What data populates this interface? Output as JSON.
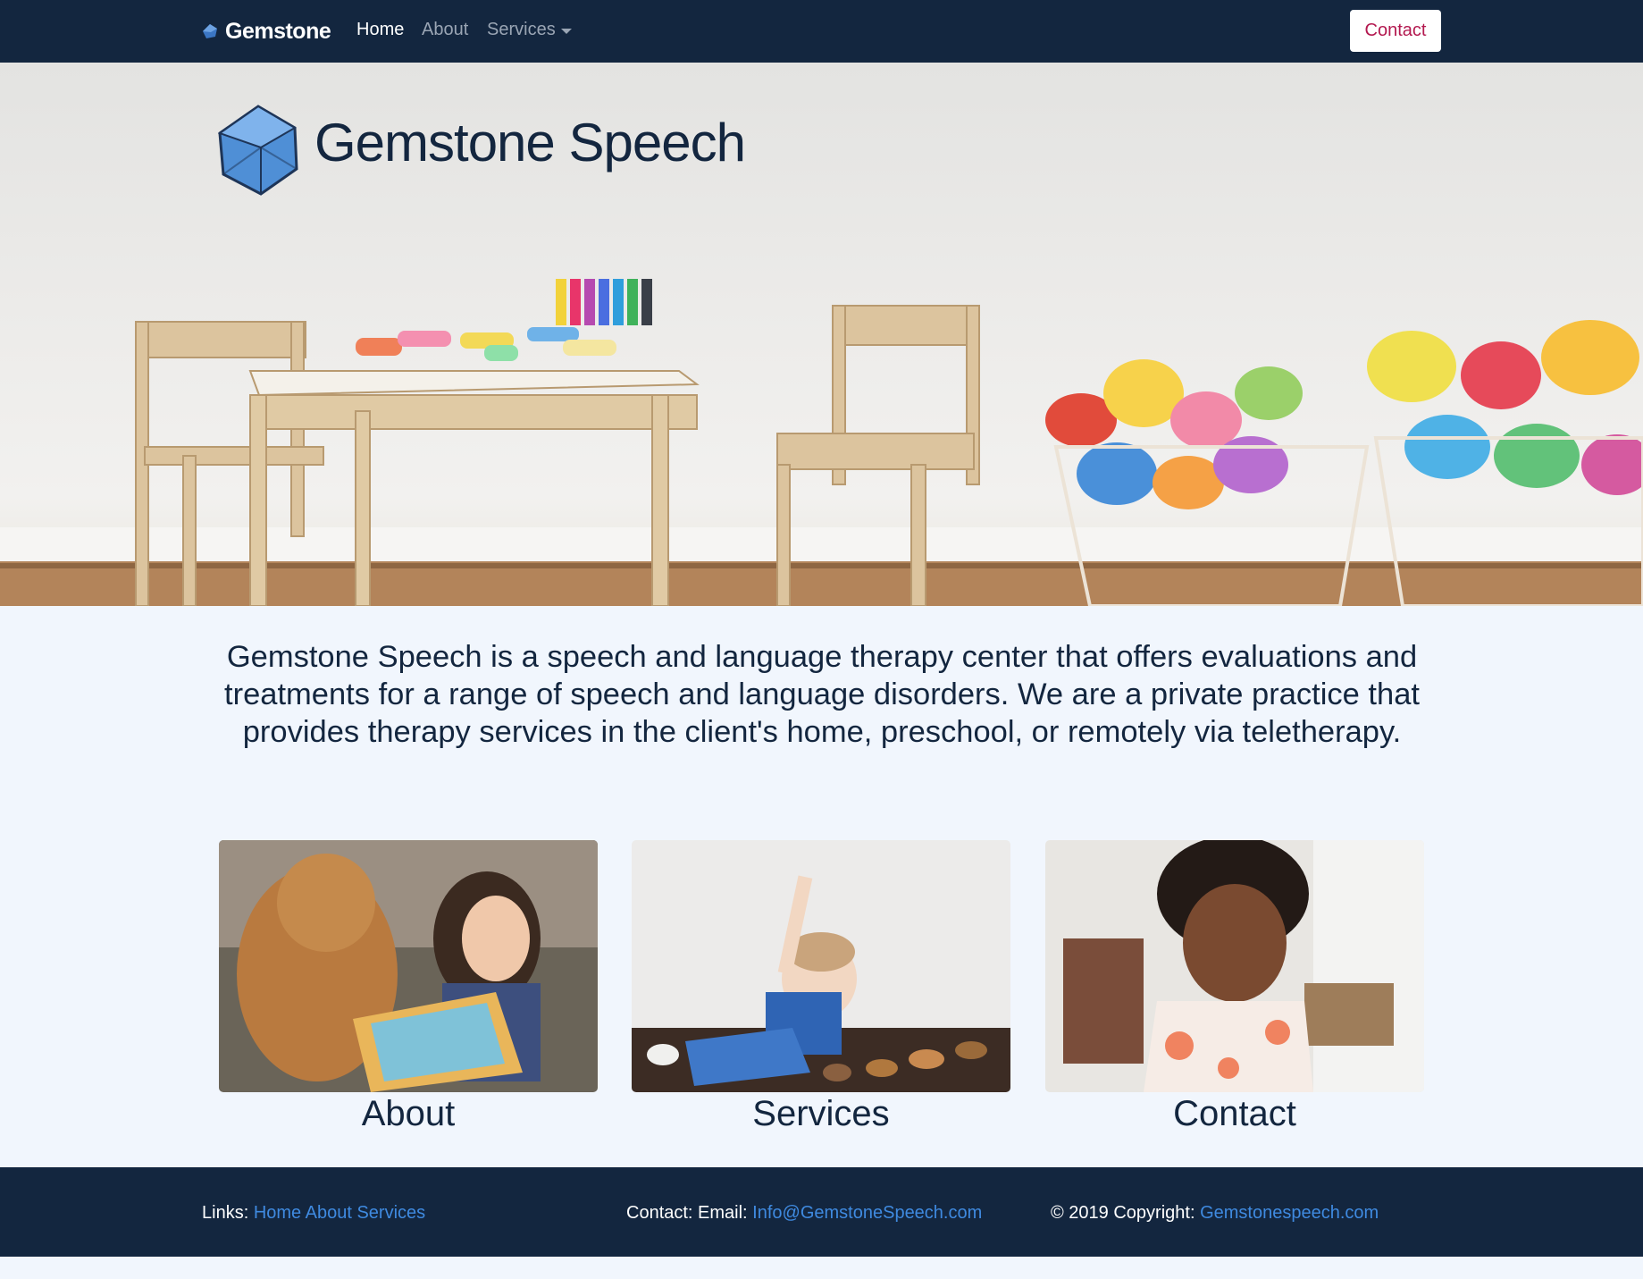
{
  "nav": {
    "brand": "Gemstone",
    "links": [
      "Home",
      "About",
      "Services"
    ],
    "contact_button": "Contact"
  },
  "hero": {
    "title": "Gemstone Speech"
  },
  "intro": {
    "text": "Gemstone Speech is a speech and language therapy center that offers evaluations and treatments for a range of speech and language disorders. We are a private practice that provides therapy services in the client's home, preschool, or remotely via teletherapy."
  },
  "cards": [
    {
      "label": "About"
    },
    {
      "label": "Services"
    },
    {
      "label": "Contact"
    }
  ],
  "footer": {
    "links_label": "Links:",
    "links": [
      "Home",
      "About",
      "Services"
    ],
    "contact_label": "Contact: Email:",
    "email": "Info@GemstoneSpeech.com",
    "copyright_label": "© 2019 Copyright:",
    "site": "Gemstonespeech.com"
  },
  "colors": {
    "navy": "#13263f",
    "background": "#f1f6fd",
    "link_blue": "#3f8ae0",
    "contact_red": "#b3184f"
  }
}
